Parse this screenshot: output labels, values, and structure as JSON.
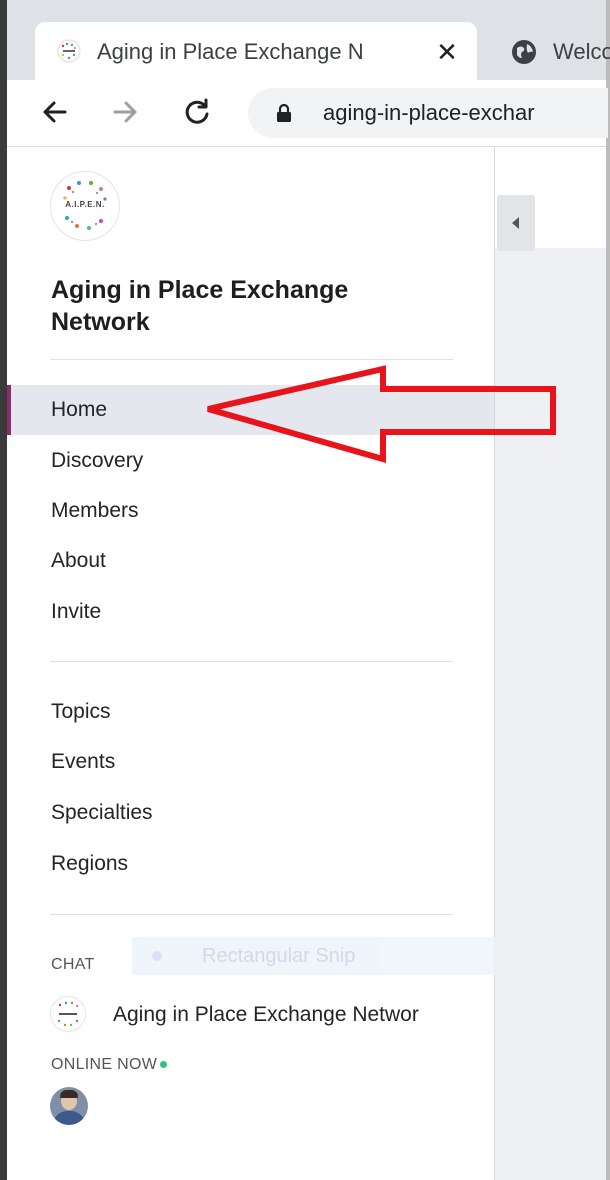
{
  "browser": {
    "active_tab": {
      "title": "Aging in Place Exchange N",
      "close_glyph": "✕",
      "favicon": "aipen-logo-icon"
    },
    "inactive_tab": {
      "title": "Welco",
      "icon": "globe-icon"
    },
    "toolbar": {
      "back_icon": "back-arrow-icon",
      "forward_icon": "forward-arrow-icon",
      "reload_icon": "reload-icon",
      "lock_icon": "lock-icon",
      "url": "aging-in-place-exchar"
    }
  },
  "sidebar": {
    "logo_text": "A.I.P.E.N.",
    "network_title": "Aging in Place Exchange Network",
    "primary_nav": [
      {
        "label": "Home",
        "active": true
      },
      {
        "label": "Discovery",
        "active": false
      },
      {
        "label": "Members",
        "active": false
      },
      {
        "label": "About",
        "active": false
      },
      {
        "label": "Invite",
        "active": false
      }
    ],
    "secondary_nav": [
      {
        "label": "Topics"
      },
      {
        "label": "Events"
      },
      {
        "label": "Specialties"
      },
      {
        "label": "Regions"
      }
    ],
    "chat": {
      "section_label": "CHAT",
      "items": [
        {
          "name": "Aging in Place Exchange Networ"
        }
      ]
    },
    "online": {
      "section_label": "ONLINE NOW"
    }
  },
  "overlay": {
    "snip_text": "Rectangular Snip"
  },
  "colors": {
    "active_accent": "#8e2a6e",
    "annotation_arrow": "#e8141c",
    "online_dot": "#2ec27e"
  }
}
